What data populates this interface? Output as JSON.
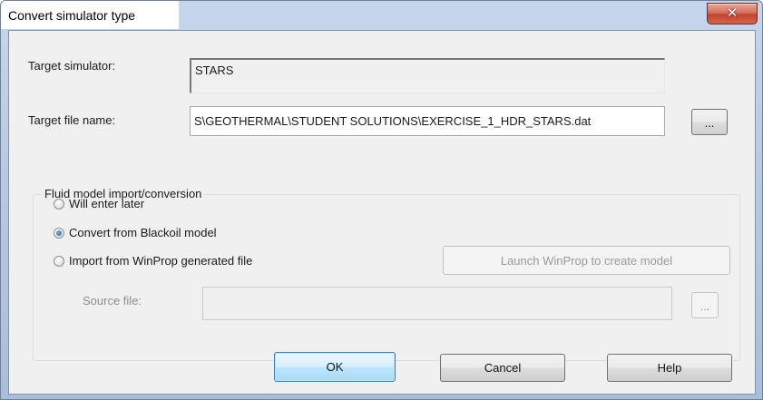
{
  "window": {
    "title": "Convert simulator type",
    "close_icon": "close-icon"
  },
  "target_simulator": {
    "label": "Target simulator:",
    "value": "STARS"
  },
  "target_file": {
    "label": "Target file name:",
    "value": "S\\GEOTHERMAL\\STUDENT SOLUTIONS\\EXERCISE_1_HDR_STARS.dat",
    "browse_label": "..."
  },
  "fluid_model": {
    "group_title": "Fluid model import/conversion",
    "options": [
      {
        "label": "Will enter later",
        "checked": false
      },
      {
        "label": "Convert from Blackoil model",
        "checked": true
      },
      {
        "label": "Import from WinProp generated file",
        "checked": false
      }
    ],
    "launch_label": "Launch WinProp to create model",
    "source_label": "Source file:",
    "source_value": "",
    "source_browse_label": "..."
  },
  "buttons": {
    "ok": "OK",
    "cancel": "Cancel",
    "help": "Help"
  }
}
